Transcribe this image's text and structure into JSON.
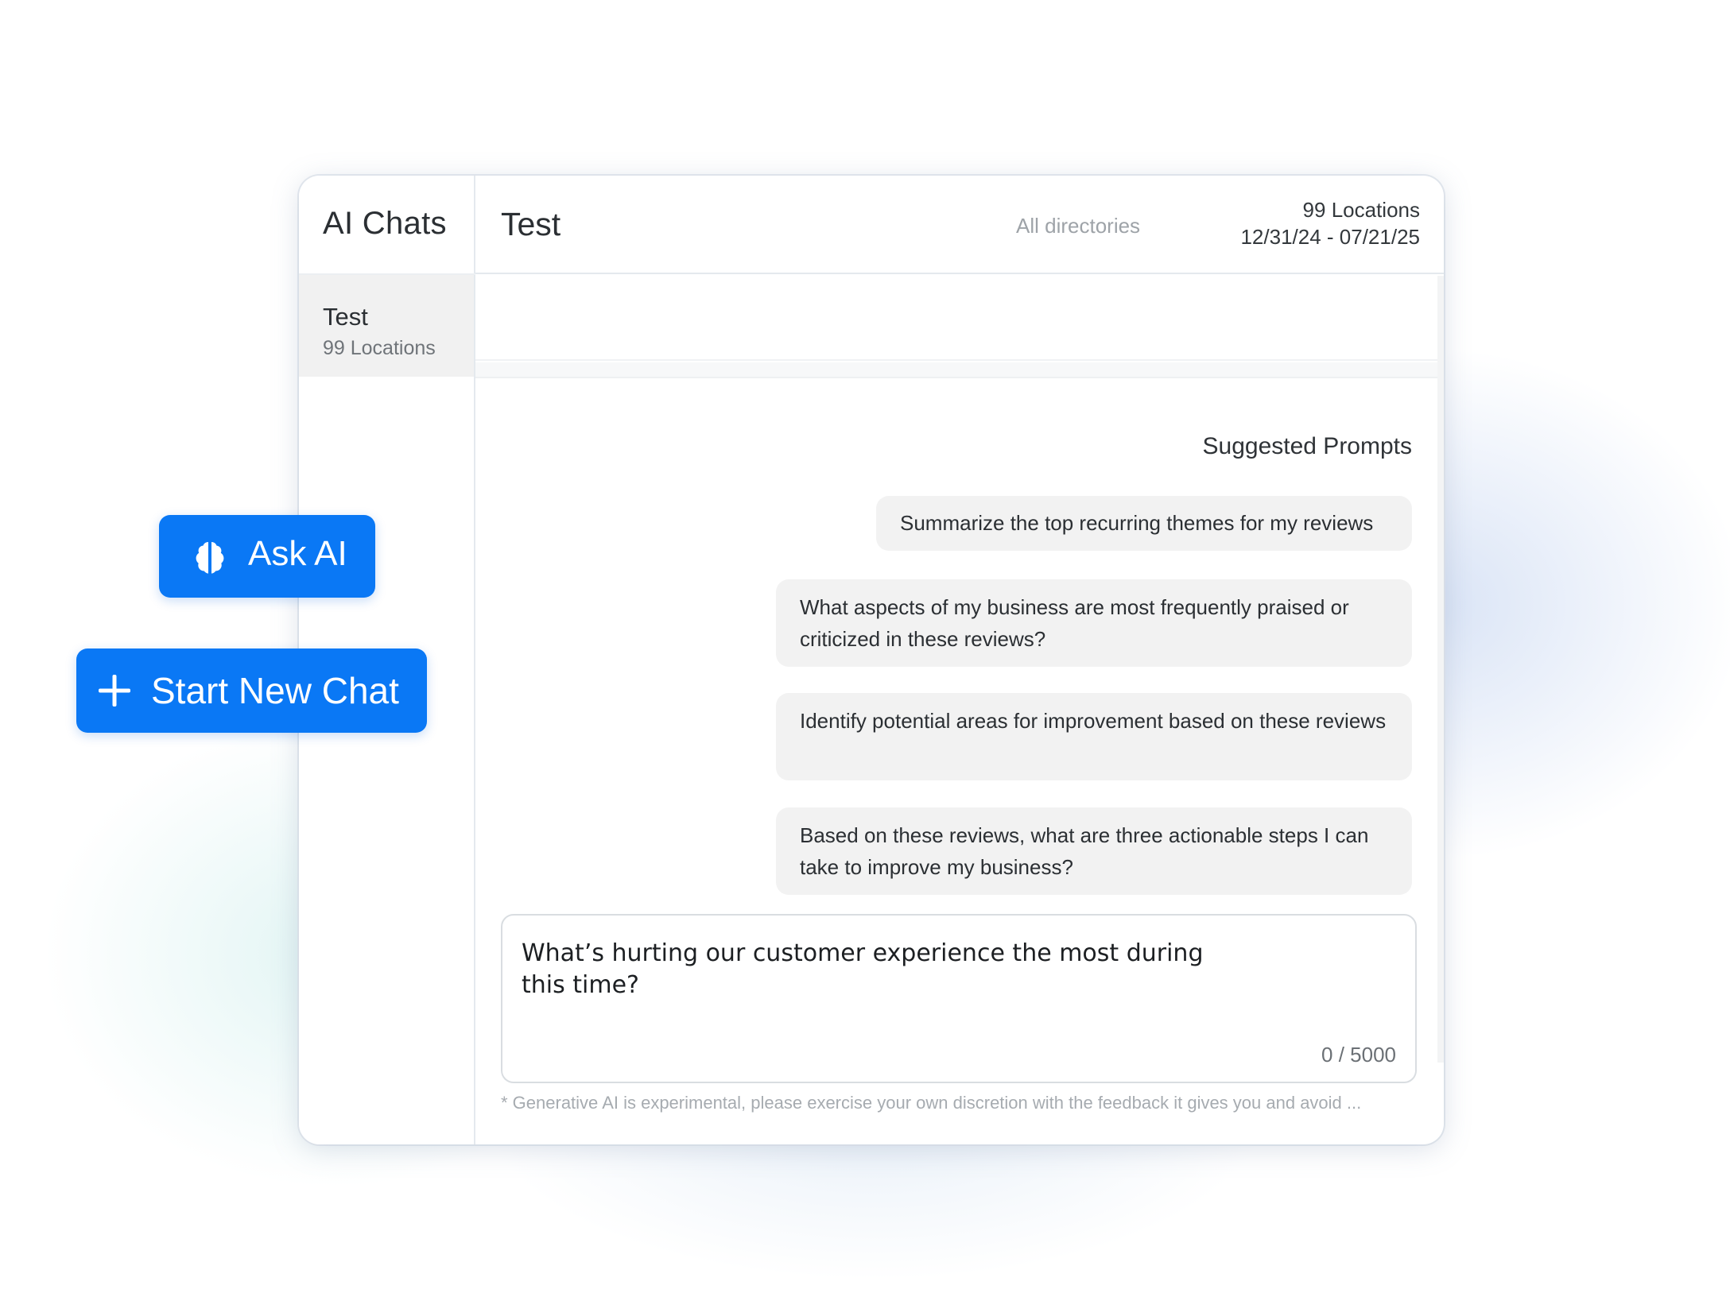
{
  "sidebar": {
    "title": "AI Chats",
    "chats": [
      {
        "title": "Test",
        "subtitle": "99 Locations"
      }
    ]
  },
  "header": {
    "chat_title": "Test",
    "directories": "All directories",
    "locations": "99 Locations",
    "date_range": "12/31/24 - 07/21/25"
  },
  "suggested": {
    "title": "Suggested Prompts",
    "prompts": [
      "Summarize the top recurring themes for my reviews",
      "What aspects of my business are most frequently praised or criticized in these reviews?",
      "Identify potential areas for improvement based on these reviews",
      "Based on these reviews, what are three actionable steps I can take to improve my business?"
    ]
  },
  "input": {
    "value": "What’s hurting our customer experience the most during this time?",
    "counter": "0 / 5000"
  },
  "disclaimer": "* Generative AI is experimental, please exercise your own discretion with the feedback it gives you and avoid ...",
  "buttons": {
    "ask_ai": "Ask AI",
    "start_new_chat": "Start New Chat"
  },
  "icons": {
    "ask_ai": "brain-icon",
    "start_new_chat": "plus-icon"
  },
  "colors": {
    "accent": "#0a78f5",
    "prompt_bg": "#f2f2f2",
    "sidebar_selected": "#f1f1f1"
  }
}
